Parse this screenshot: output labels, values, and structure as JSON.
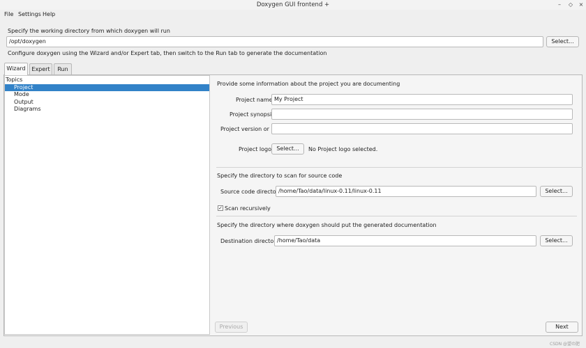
{
  "window": {
    "title": "Doxygen GUI frontend +",
    "controls": {
      "minimize": "–",
      "maximize": "◇",
      "close": "×"
    }
  },
  "menu": {
    "items": [
      "File",
      "Settings",
      "Help"
    ]
  },
  "working_dir": {
    "prompt": "Specify the working directory from which doxygen will run",
    "value": "/opt/doxygen",
    "select_label": "Select...",
    "hint": "Configure doxygen using the Wizard and/or Expert tab, then switch to the Run tab to generate the documentation"
  },
  "tabs": [
    "Wizard",
    "Expert",
    "Run"
  ],
  "topics": {
    "header": "Topics",
    "items": [
      "Project",
      "Mode",
      "Output",
      "Diagrams"
    ]
  },
  "project": {
    "intro": "Provide some information about the project you are documenting",
    "name_label": "Project name:",
    "name_value": "My Project",
    "synopsis_label": "Project synopsis:",
    "synopsis_value": "",
    "version_label": "Project version or id:",
    "version_value": "",
    "logo_label": "Project logo:",
    "logo_button": "Select...",
    "logo_status": "No Project logo selected."
  },
  "source": {
    "intro": "Specify the directory to scan for source code",
    "label": "Source code directory:",
    "value": "/home/Tao/data/linux-0.11/linux-0.11",
    "select_label": "Select...",
    "recursive_label": "Scan recursively",
    "recursive_checked": true
  },
  "destination": {
    "intro": "Specify the directory where doxygen should put the generated documentation",
    "label": "Destination directory:",
    "value": "/home/Tao/data",
    "select_label": "Select..."
  },
  "nav": {
    "previous": "Previous",
    "next": "Next"
  },
  "watermark": "CSDN @望の肥"
}
